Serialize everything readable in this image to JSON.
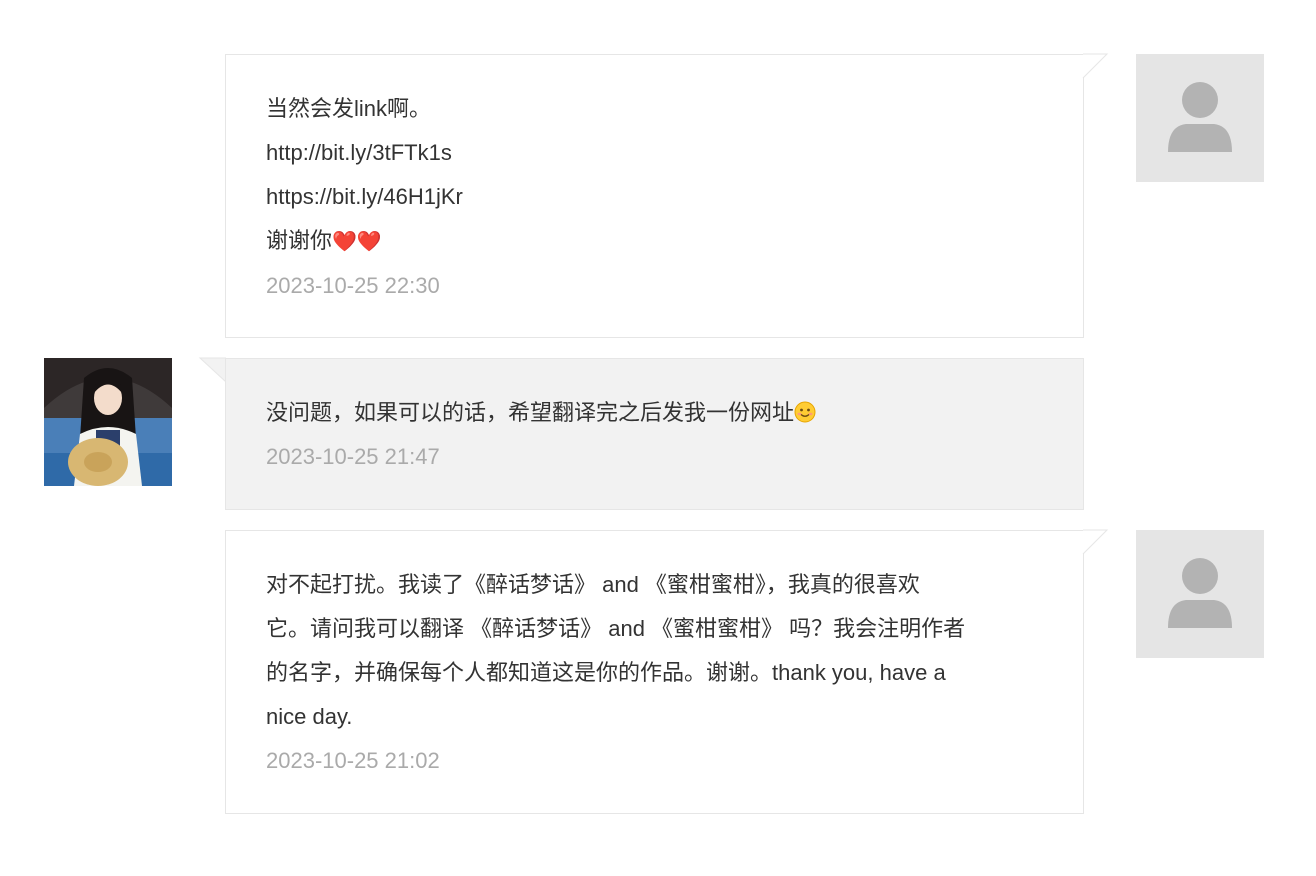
{
  "colors": {
    "sent_bubble_bg": "#ffffff",
    "received_bubble_bg": "#f2f2f2",
    "bubble_border": "#e6e6e6",
    "text": "#333333",
    "timestamp": "#aaaaaa",
    "placeholder_avatar_bg": "#e5e5e5",
    "placeholder_avatar_fg": "#b3b3b3"
  },
  "messages": [
    {
      "direction": "sent",
      "avatar": "default-user-icon",
      "lines": [
        "当然会发link啊。",
        "http://bit.ly/3tFTk1s",
        "https://bit.ly/46H1jKr",
        "谢谢你"
      ],
      "emoji": "❤️❤️",
      "time": "2023-10-25 22:30"
    },
    {
      "direction": "received",
      "avatar": "girl-with-umbrella-avatar",
      "lines": [
        "没问题，如果可以的话，希望翻译完之后发我一份网址"
      ],
      "emoji": "smiling-face-emoji",
      "time": "2023-10-25 21:47"
    },
    {
      "direction": "sent",
      "avatar": "default-user-icon",
      "lines": [
        "对不起打扰。我读了《醉话梦话》 and 《蜜柑蜜柑》，我真的很喜欢",
        "它。请问我可以翻译 《醉话梦话》 and 《蜜柑蜜柑》 吗？我会注明作者",
        "的名字，并确保每个人都知道这是你的作品。谢谢。thank you, have a",
        "nice day."
      ],
      "time": "2023-10-25 21:02"
    }
  ]
}
